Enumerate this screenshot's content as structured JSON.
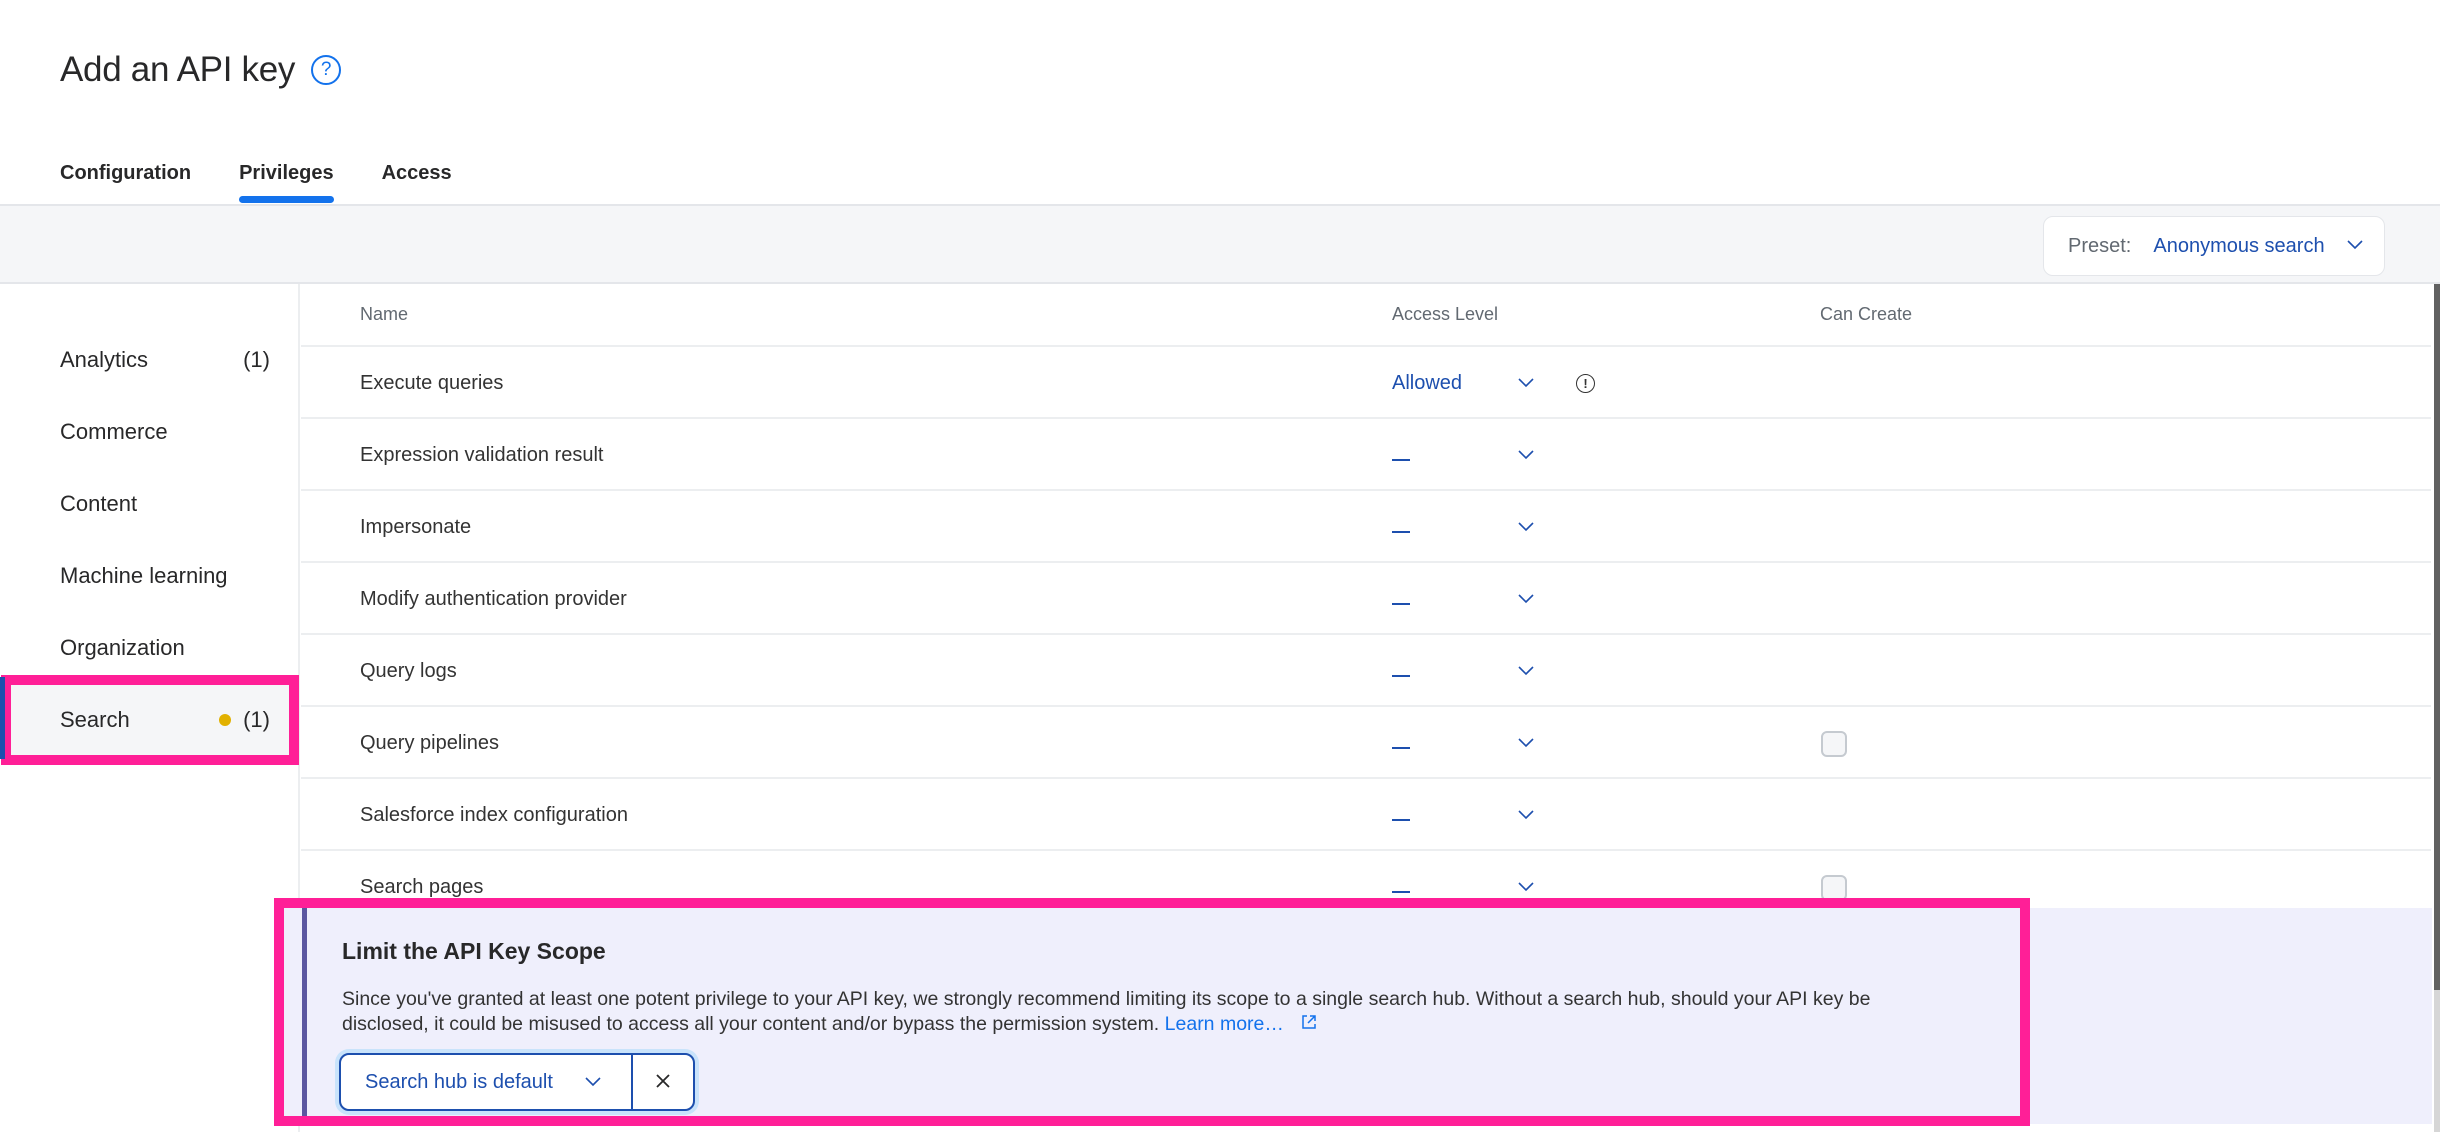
{
  "header": {
    "title": "Add an API key",
    "help_icon": "question-circle-icon"
  },
  "tabs": [
    {
      "label": "Configuration",
      "active": false
    },
    {
      "label": "Privileges",
      "active": true
    },
    {
      "label": "Access",
      "active": false
    }
  ],
  "preset": {
    "label": "Preset:",
    "value": "Anonymous search",
    "icon": "chevron-down-icon"
  },
  "sidebar": {
    "items": [
      {
        "label": "Analytics",
        "count": "(1)",
        "active": false,
        "modified": false
      },
      {
        "label": "Commerce",
        "count": "",
        "active": false,
        "modified": false
      },
      {
        "label": "Content",
        "count": "",
        "active": false,
        "modified": false
      },
      {
        "label": "Machine learning",
        "count": "",
        "active": false,
        "modified": false
      },
      {
        "label": "Organization",
        "count": "",
        "active": false,
        "modified": false
      },
      {
        "label": "Search",
        "count": "(1)",
        "active": true,
        "modified": true
      }
    ]
  },
  "table": {
    "columns": {
      "name": "Name",
      "access_level": "Access Level",
      "can_create": "Can Create"
    },
    "rows": [
      {
        "name": "Execute queries",
        "access": "Allowed",
        "info_icon": true,
        "can_create_checkbox": false
      },
      {
        "name": "Expression validation result",
        "access": "—",
        "info_icon": false,
        "can_create_checkbox": false
      },
      {
        "name": "Impersonate",
        "access": "—",
        "info_icon": false,
        "can_create_checkbox": false
      },
      {
        "name": "Modify authentication provider",
        "access": "—",
        "info_icon": false,
        "can_create_checkbox": false
      },
      {
        "name": "Query logs",
        "access": "—",
        "info_icon": false,
        "can_create_checkbox": false
      },
      {
        "name": "Query pipelines",
        "access": "—",
        "info_icon": false,
        "can_create_checkbox": true,
        "checked": false
      },
      {
        "name": "Salesforce index configuration",
        "access": "—",
        "info_icon": false,
        "can_create_checkbox": false
      },
      {
        "name": "Search pages",
        "access": "—",
        "info_icon": false,
        "can_create_checkbox": true,
        "checked": false
      }
    ]
  },
  "banner": {
    "title": "Limit the API Key Scope",
    "text": "Since you've granted at least one potent privilege to your API key, we strongly recommend limiting its scope to a single search hub. Without a search hub, should your API key be disclosed, it could be misused to access all your content and/or bypass the permission system.",
    "link_label": "Learn more…",
    "link_icon": "external-link-icon",
    "hub_select_value": "Search hub is default",
    "clear_icon": "close-icon"
  },
  "colors": {
    "accent": "#1372ec",
    "link": "#1d4fae",
    "highlight": "#ff1f97",
    "modified_dot": "#e2b100",
    "banner_bg": "#efeffc"
  }
}
